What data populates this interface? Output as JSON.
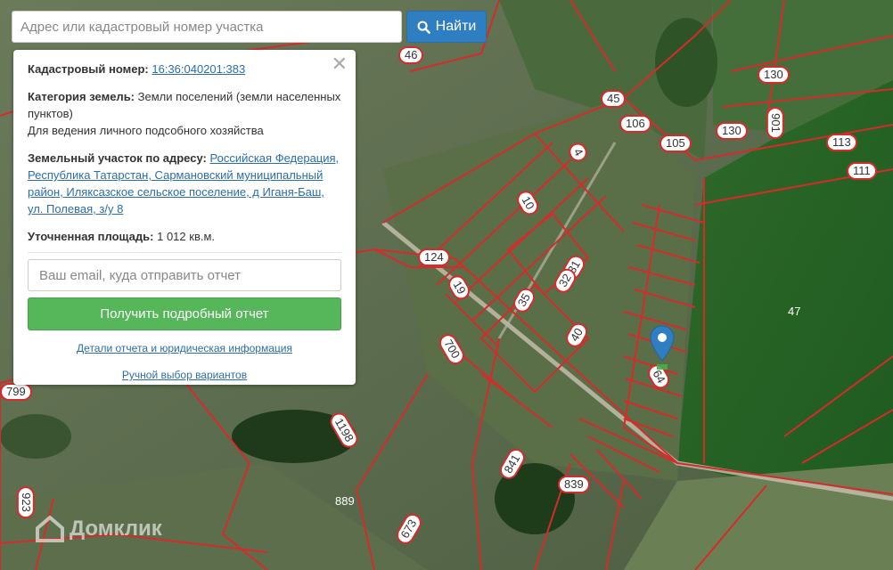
{
  "search": {
    "placeholder": "Адрес или кадастровый номер участка",
    "button_label": "Найти"
  },
  "panel": {
    "cadastral_label": "Кадастровый номер:",
    "cadastral_value": "16:36:040201:383",
    "category_label": "Категория земель:",
    "category_value": "Земли поселений (земли населенных пунктов)",
    "usage": "Для ведения личного подсобного хозяйства",
    "address_label": "Земельный участок по адресу:",
    "address_value": "Российская Федерация, Республика Татарстан, Сармановский муниципальный район, Иляксазское сельское поселение, д Иганя-Баш, ул. Полевая, з/у 8",
    "area_label": "Уточненная площадь:",
    "area_value": "1 012 кв.м.",
    "email_placeholder": "Ваш email, куда отправить отчет",
    "report_button": "Получить подробный отчет",
    "details_link": "Детали отчета и юридическая информация",
    "manual_link": "Ручной выбор вариантов"
  },
  "parcel_labels": {
    "p46": "46",
    "p45": "45",
    "p106": "106",
    "p105": "105",
    "p130a": "130",
    "p130b": "130",
    "p901": "901",
    "p113": "113",
    "p111": "111",
    "p4": "4",
    "p10": "10",
    "p124": "124",
    "p19": "19",
    "p35": "35",
    "p31": "31",
    "p32": "32",
    "p40": "40",
    "p47": "47",
    "p64": "64",
    "p700": "700",
    "p799": "799",
    "p1198": "1198",
    "p841": "841",
    "p839": "839",
    "p889": "889",
    "p673": "673",
    "p923": "923"
  },
  "brand": {
    "name": "Домклик"
  },
  "colors": {
    "parcel_border": "#d52b2b",
    "search_button": "#2f7ec1",
    "report_button": "#56b65a",
    "link": "#2a6eaa",
    "marker": "#2f7ec1"
  }
}
